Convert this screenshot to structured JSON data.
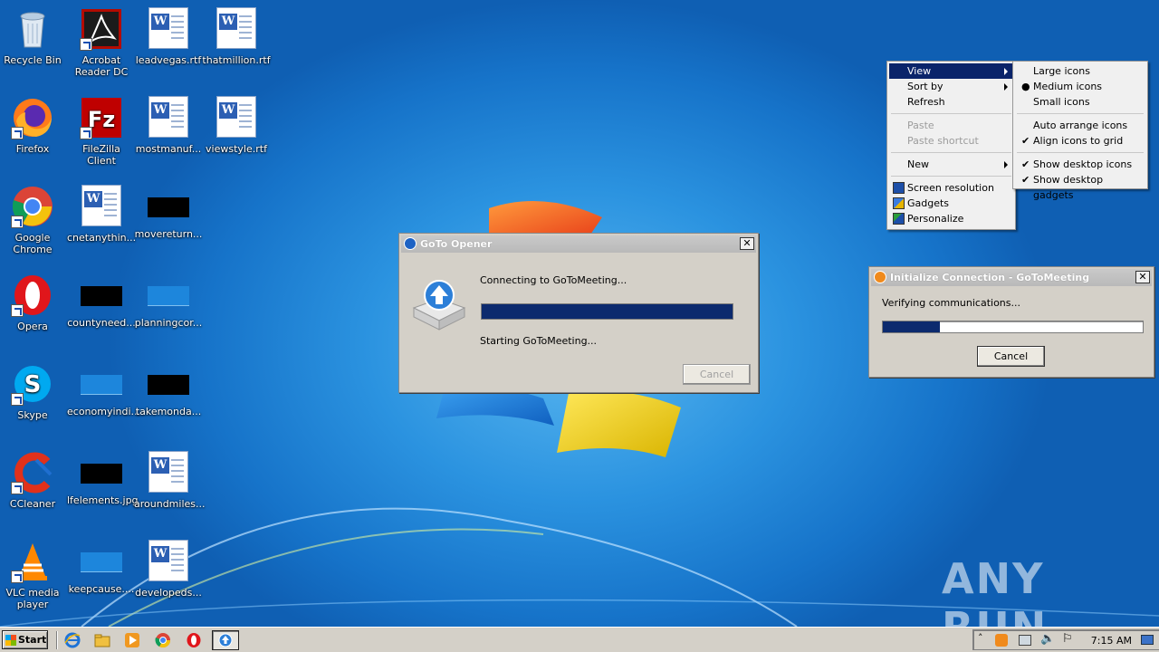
{
  "desktop": {
    "icons": [
      {
        "label": "Recycle Bin",
        "icon": "recycle-bin-icon"
      },
      {
        "label": "Acrobat Reader DC",
        "icon": "acrobat-icon"
      },
      {
        "label": "leadvegas.rtf",
        "icon": "word-document-icon"
      },
      {
        "label": "thatmillion.rtf",
        "icon": "word-document-icon"
      },
      {
        "label": "Firefox",
        "icon": "firefox-icon"
      },
      {
        "label": "FileZilla Client",
        "icon": "filezilla-icon"
      },
      {
        "label": "mostmanuf...",
        "icon": "word-document-icon"
      },
      {
        "label": "viewstyle.rtf",
        "icon": "word-document-icon"
      },
      {
        "label": "Google Chrome",
        "icon": "chrome-icon"
      },
      {
        "label": "cnetanythin...",
        "icon": "word-document-icon"
      },
      {
        "label": "movereturn...",
        "icon": "image-thumbnail-icon"
      },
      {
        "label": "Opera",
        "icon": "opera-icon"
      },
      {
        "label": "countyneed...",
        "icon": "image-thumbnail-icon"
      },
      {
        "label": "planningcor...",
        "icon": "image-thumbnail-icon"
      },
      {
        "label": "Skype",
        "icon": "skype-icon"
      },
      {
        "label": "economyindi...",
        "icon": "image-thumbnail-icon"
      },
      {
        "label": "takemonda...",
        "icon": "image-thumbnail-icon"
      },
      {
        "label": "CCleaner",
        "icon": "ccleaner-icon"
      },
      {
        "label": "lfelements.jpg",
        "icon": "image-thumbnail-icon"
      },
      {
        "label": "aroundmiles...",
        "icon": "word-document-icon"
      },
      {
        "label": "VLC media player",
        "icon": "vlc-icon"
      },
      {
        "label": "keepcause....",
        "icon": "image-thumbnail-icon"
      },
      {
        "label": "developeds...",
        "icon": "word-document-icon"
      }
    ]
  },
  "goto_opener": {
    "title": "GoTo Opener",
    "status_top": "Connecting to GoToMeeting...",
    "status_bottom": "Starting GoToMeeting...",
    "progress": 1.0,
    "cancel_label": "Cancel",
    "close_label": "✕"
  },
  "init_connection": {
    "title": "Initialize Connection - GoToMeeting",
    "status": "Verifying communications...",
    "progress": 0.22,
    "cancel_label": "Cancel",
    "close_label": "✕"
  },
  "context_menu": {
    "main": {
      "view": "View",
      "sort_by": "Sort by",
      "refresh": "Refresh",
      "paste": "Paste",
      "paste_shortcut": "Paste shortcut",
      "new": "New",
      "screen_resolution": "Screen resolution",
      "gadgets": "Gadgets",
      "personalize": "Personalize"
    },
    "view_submenu": {
      "large_icons": "Large icons",
      "medium_icons": "Medium icons",
      "small_icons": "Small icons",
      "auto_arrange": "Auto arrange icons",
      "align_to_grid": "Align icons to grid",
      "show_desktop_icons": "Show desktop icons",
      "show_desktop_gadgets": "Show desktop gadgets"
    }
  },
  "taskbar": {
    "start_label": "Start",
    "clock": "7:15 AM",
    "quicklaunch": [
      "ie-icon",
      "explorer-icon",
      "media-player-icon",
      "chrome-icon",
      "opera-icon",
      "goto-opener-icon"
    ]
  },
  "watermark": "ANY RUN",
  "colors": {
    "accent_menu": "#0a246a",
    "progress_fill": "#0c2a6e",
    "desktop_blue": "#1a7fd4"
  }
}
